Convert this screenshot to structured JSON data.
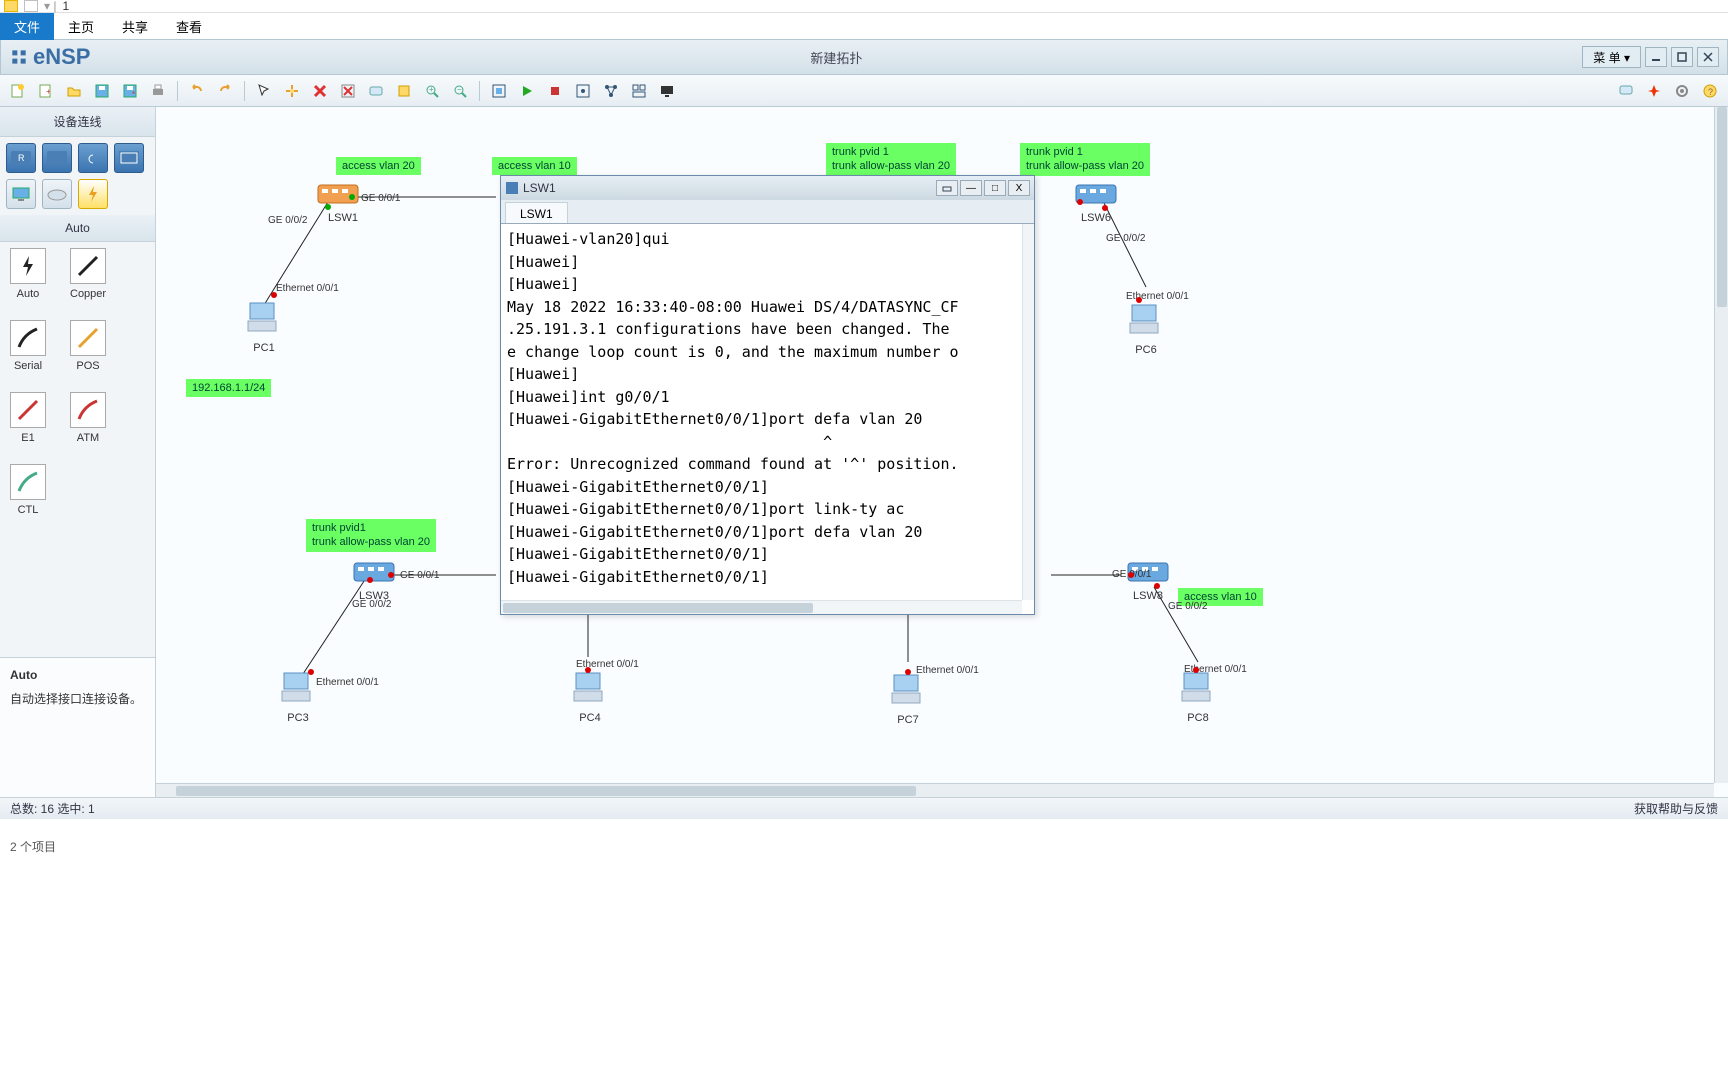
{
  "explorer": {
    "path_placeholder": "1",
    "tabs": [
      "文件",
      "主页",
      "共享",
      "查看"
    ],
    "bottom": "2 个项目"
  },
  "ensp": {
    "logo_text": "eNSP",
    "title": "新建拓扑",
    "menu_button": "菜 单 ▾",
    "toolbar_right_icons": [
      "chat-icon",
      "huawei-icon",
      "gear-icon",
      "help-icon"
    ]
  },
  "sidebar": {
    "devices_title": "设备连线",
    "auto_title": "Auto",
    "connections": [
      {
        "label": "Auto",
        "icon": "lightning"
      },
      {
        "label": "Copper",
        "icon": "copper"
      },
      {
        "label": "Serial",
        "icon": "serial"
      },
      {
        "label": "POS",
        "icon": "pos"
      },
      {
        "label": "E1",
        "icon": "e1"
      },
      {
        "label": "ATM",
        "icon": "atm"
      },
      {
        "label": "CTL",
        "icon": "ctl"
      }
    ],
    "desc_title": "Auto",
    "desc_body": "自动选择接口连接设备。"
  },
  "canvas": {
    "nodes": {
      "LSW1": "LSW1",
      "LSW3": "LSW3",
      "LSW6": "LSW6",
      "LSW8": "LSW8",
      "PC1": "PC1",
      "PC3": "PC3",
      "PC4": "PC4",
      "PC6": "PC6",
      "PC7": "PC7",
      "PC8": "PC8"
    },
    "annotations": {
      "a1": "access vlan 20",
      "a2": "access vlan 10",
      "a3": "trunk pvid 1\ntrunk allow-pass vlan 20",
      "a4": "trunk pvid 1\ntrunk allow-pass vlan 20",
      "a5": "192.168.1.1/24",
      "a6": "trunk pvid1\ntrunk allow-pass vlan 20",
      "a7": "access vlan 10"
    },
    "ports": {
      "p_lsw1_g01": "GE 0/0/1",
      "p_lsw1_g02": "GE 0/0/2",
      "p_pc1_e01": "Ethernet 0/0/1",
      "p_lsw3_g01": "GE 0/0/1",
      "p_lsw3_g02": "GE 0/0/2",
      "p_pc3_e01": "Ethernet 0/0/1",
      "p_pc4_e01": "Ethernet 0/0/1",
      "p_pc7_e01": "Ethernet 0/0/1",
      "p_lsw6_g02": "GE 0/0/2",
      "p_pc6_e01": "Ethernet 0/0/1",
      "p_lsw8_g01": "GE 0/0/1",
      "p_lsw8_g02": "GE 0/0/2",
      "p_pc8_e01": "Ethernet 0/0/1"
    }
  },
  "terminal": {
    "window_title": "LSW1",
    "tab": "LSW1",
    "content": "[Huawei-vlan20]qui\n[Huawei]\n[Huawei]\nMay 18 2022 16:33:40-08:00 Huawei DS/4/DATASYNC_CF\n.25.191.3.1 configurations have been changed. The\ne change loop count is 0, and the maximum number o\n[Huawei]\n[Huawei]int g0/0/1\n[Huawei-GigabitEthernet0/0/1]port defa vlan 20\n                                   ^\nError: Unrecognized command found at '^' position.\n[Huawei-GigabitEthernet0/0/1]\n[Huawei-GigabitEthernet0/0/1]port link-ty ac\n[Huawei-GigabitEthernet0/0/1]port defa vlan 20\n[Huawei-GigabitEthernet0/0/1]\n[Huawei-GigabitEthernet0/0/1]"
  },
  "status": {
    "left": "总数: 16 选中: 1",
    "right": "获取帮助与反馈"
  }
}
